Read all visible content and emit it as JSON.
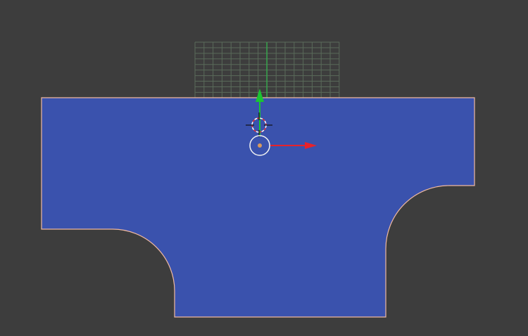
{
  "viewport": {
    "background_color": "#3d3d3d",
    "grid_color": "#5a6a5a",
    "grid_axis_color": "#2fb34a",
    "mesh_fill_color": "#3a52ad",
    "mesh_outline_color": "#f0b9a0"
  },
  "gizmo": {
    "x_axis_color": "#e8222a",
    "y_axis_color": "#19c532",
    "origin_color": "#d89a5e",
    "cursor_ring_colors": [
      "#ffffff",
      "#e0323a"
    ],
    "icons": {
      "x_axis_arrow": "arrow-right-icon",
      "y_axis_arrow": "arrow-up-icon",
      "origin": "object-origin-icon",
      "cursor": "3d-cursor-icon"
    }
  }
}
